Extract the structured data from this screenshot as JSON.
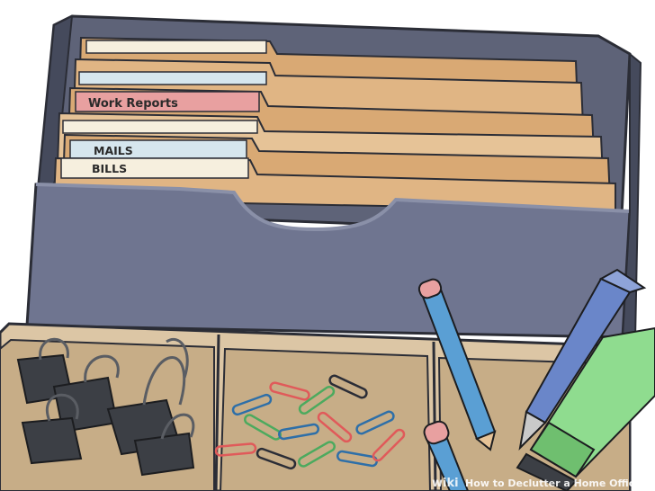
{
  "folders": {
    "work_reports_label": "Work Reports",
    "mails_label": "MAILS",
    "bills_label": "BILLS"
  },
  "watermark": {
    "brand": "wiki",
    "title": "How to Declutter a Home Office"
  },
  "colors": {
    "box": "#5e6378",
    "box_light": "#6f7590",
    "box_dark": "#454a5c",
    "folder": "#d9a974",
    "folder_light": "#e6c397",
    "label_pink": "#e8a0a0",
    "label_blue": "#d6e6ee",
    "label_cream": "#f6efde",
    "tray": "#dcc6a5",
    "tray_dark": "#c7ad87",
    "clip_dark": "#3c3f45",
    "pencil_blue": "#5a9fd4",
    "pen_blue": "#6a86c9",
    "highlighter_green": "#8fdc8f"
  }
}
